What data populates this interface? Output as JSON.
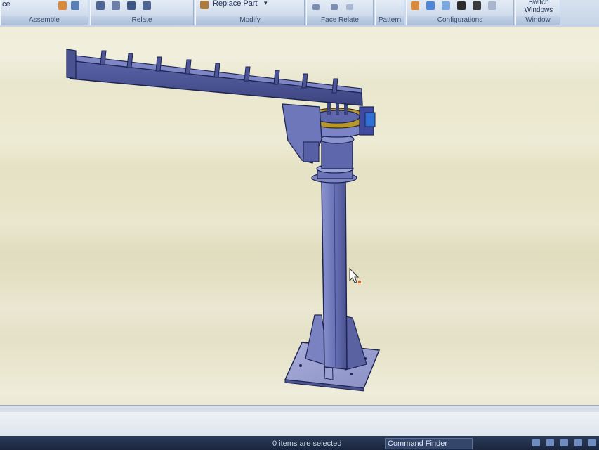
{
  "ribbon": {
    "groups": [
      {
        "name": "assemble",
        "caption": "Assemble",
        "text": "ce"
      },
      {
        "name": "relate",
        "caption": "Relate"
      },
      {
        "name": "modify",
        "caption": "Modify",
        "replace_part_label": "Replace Part"
      },
      {
        "name": "face-relate",
        "caption": "Face Relate"
      },
      {
        "name": "pattern",
        "caption": "Pattern"
      },
      {
        "name": "configurations",
        "caption": "Configurations"
      },
      {
        "name": "window",
        "caption": "Window",
        "switch_windows_label": "Switch Windows"
      }
    ]
  },
  "statusbar": {
    "selection_text": "0 items are selected",
    "command_finder_label": "Command Finder"
  },
  "colors": {
    "model_face": "#6a73b8",
    "model_edge": "#1d2550",
    "bearing_ring": "#b8962a",
    "accent_blue": "#2f6fd6"
  },
  "model": {
    "description_icon": "jib-crane-icon"
  }
}
